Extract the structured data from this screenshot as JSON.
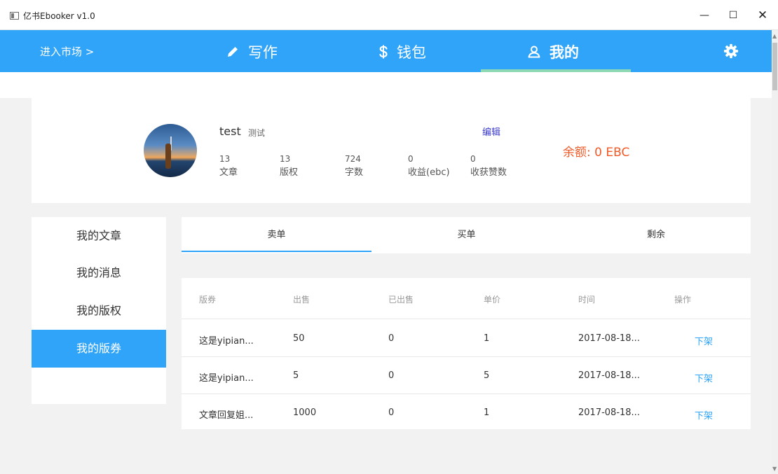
{
  "window": {
    "title": "亿书Ebooker v1.0",
    "minimize": "—",
    "maximize": "☐",
    "close": "✕"
  },
  "nav": {
    "market": "进入市场 >",
    "tabs": [
      {
        "label": "写作",
        "icon": "pencil-icon"
      },
      {
        "label": "钱包",
        "icon": "dollar-icon"
      },
      {
        "label": "我的",
        "icon": "user-icon"
      }
    ],
    "active_tab": "我的",
    "settings_icon": "gear-icon"
  },
  "profile": {
    "name": "test",
    "nickname": "测试",
    "edit": "编辑",
    "balance": "余额:  0  EBC",
    "stats": [
      {
        "value": "13",
        "label": "文章"
      },
      {
        "value": "13",
        "label": "版权"
      },
      {
        "value": "724",
        "label": "字数"
      },
      {
        "value": "0",
        "label": "收益(ebc)"
      },
      {
        "value": "0",
        "label": "收获赞数"
      }
    ]
  },
  "menu": {
    "items": [
      "我的文章",
      "我的消息",
      "我的版权",
      "我的版券"
    ],
    "active": "我的版券"
  },
  "sub_tabs": {
    "items": [
      "卖单",
      "买单",
      "剩余"
    ],
    "active": "卖单"
  },
  "table": {
    "headers": [
      "版券",
      "出售",
      "已出售",
      "单价",
      "时间",
      "操作"
    ],
    "rows": [
      [
        "这是yipian...",
        "50",
        "0",
        "1",
        "2017-08-18...",
        "下架"
      ],
      [
        "这是yipian...",
        "5",
        "0",
        "5",
        "2017-08-18...",
        "下架"
      ],
      [
        "文章回复姐...",
        "1000",
        "0",
        "1",
        "2017-08-18...",
        "下架"
      ]
    ]
  },
  "colors": {
    "primary": "#2fa4f8",
    "tab_indicator": "#8fd8b4",
    "balance": "#f05a28",
    "edit_link": "#3b3bd0",
    "background": "#f2f2f2"
  }
}
